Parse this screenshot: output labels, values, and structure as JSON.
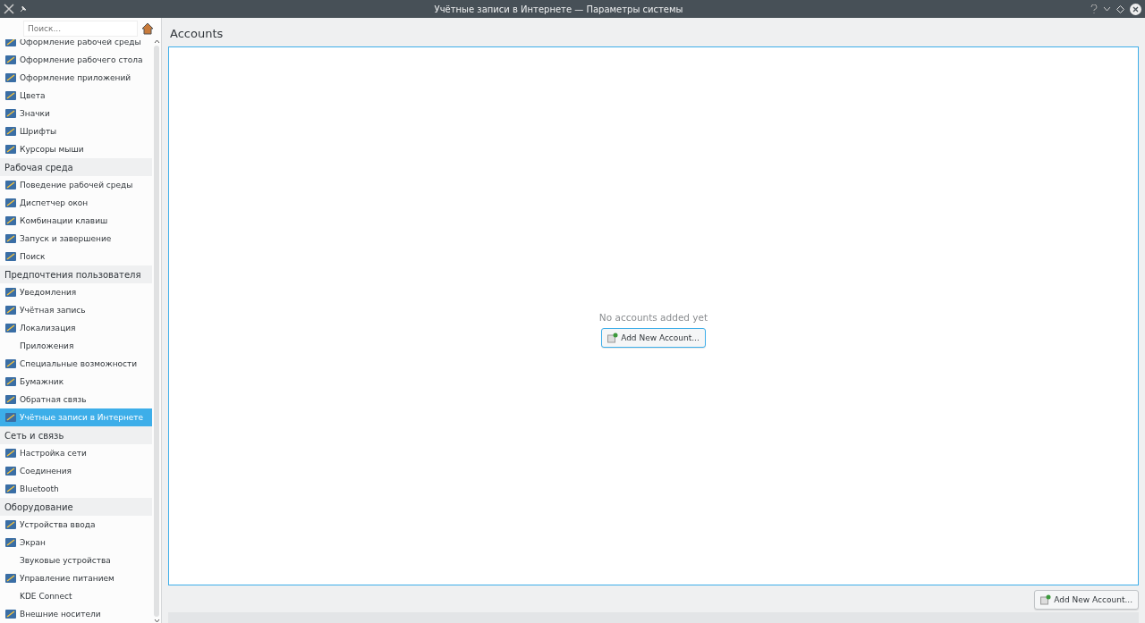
{
  "window": {
    "title": "Учётные записи в Интернете — Параметры системы"
  },
  "sidebar": {
    "search": {
      "placeholder": "Поиск..."
    },
    "items": [
      {
        "kind": "item",
        "label": "Оформление рабочей среды",
        "icon": true,
        "selected": false
      },
      {
        "kind": "item",
        "label": "Оформление рабочего стола",
        "icon": true,
        "selected": false
      },
      {
        "kind": "item",
        "label": "Оформление приложений",
        "icon": true,
        "selected": false
      },
      {
        "kind": "item",
        "label": "Цвета",
        "icon": true,
        "selected": false
      },
      {
        "kind": "item",
        "label": "Значки",
        "icon": true,
        "selected": false
      },
      {
        "kind": "item",
        "label": "Шрифты",
        "icon": true,
        "selected": false
      },
      {
        "kind": "item",
        "label": "Курсоры мыши",
        "icon": true,
        "selected": false
      },
      {
        "kind": "category",
        "label": "Рабочая среда"
      },
      {
        "kind": "item",
        "label": "Поведение рабочей среды",
        "icon": true,
        "selected": false
      },
      {
        "kind": "item",
        "label": "Диспетчер окон",
        "icon": true,
        "selected": false
      },
      {
        "kind": "item",
        "label": "Комбинации клавиш",
        "icon": true,
        "selected": false
      },
      {
        "kind": "item",
        "label": "Запуск и завершение",
        "icon": true,
        "selected": false
      },
      {
        "kind": "item",
        "label": "Поиск",
        "icon": true,
        "selected": false
      },
      {
        "kind": "category",
        "label": "Предпочтения пользователя"
      },
      {
        "kind": "item",
        "label": "Уведомления",
        "icon": true,
        "selected": false
      },
      {
        "kind": "item",
        "label": "Учётная запись",
        "icon": true,
        "selected": false
      },
      {
        "kind": "item",
        "label": "Локализация",
        "icon": true,
        "selected": false
      },
      {
        "kind": "item",
        "label": "Приложения",
        "icon": false,
        "selected": false
      },
      {
        "kind": "item",
        "label": "Специальные возможности",
        "icon": true,
        "selected": false
      },
      {
        "kind": "item",
        "label": "Бумажник",
        "icon": true,
        "selected": false
      },
      {
        "kind": "item",
        "label": "Обратная связь",
        "icon": true,
        "selected": false
      },
      {
        "kind": "item",
        "label": "Учётные записи в Интернете",
        "icon": true,
        "selected": true
      },
      {
        "kind": "category",
        "label": "Сеть и связь"
      },
      {
        "kind": "item",
        "label": "Настройка сети",
        "icon": true,
        "selected": false
      },
      {
        "kind": "item",
        "label": "Соединения",
        "icon": true,
        "selected": false
      },
      {
        "kind": "item",
        "label": "Bluetooth",
        "icon": true,
        "selected": false
      },
      {
        "kind": "category",
        "label": "Оборудование"
      },
      {
        "kind": "item",
        "label": "Устройства ввода",
        "icon": true,
        "selected": false
      },
      {
        "kind": "item",
        "label": "Экран",
        "icon": true,
        "selected": false
      },
      {
        "kind": "item",
        "label": "Звуковые устройства",
        "icon": false,
        "selected": false
      },
      {
        "kind": "item",
        "label": "Управление питанием",
        "icon": true,
        "selected": false
      },
      {
        "kind": "item",
        "label": "KDE Connect",
        "icon": false,
        "selected": false
      },
      {
        "kind": "item",
        "label": "Внешние носители",
        "icon": true,
        "selected": false
      }
    ]
  },
  "content": {
    "heading": "Accounts",
    "empty_message": "No accounts added yet",
    "center_button": "Add New Account...",
    "bottom_button": "Add New Account..."
  }
}
